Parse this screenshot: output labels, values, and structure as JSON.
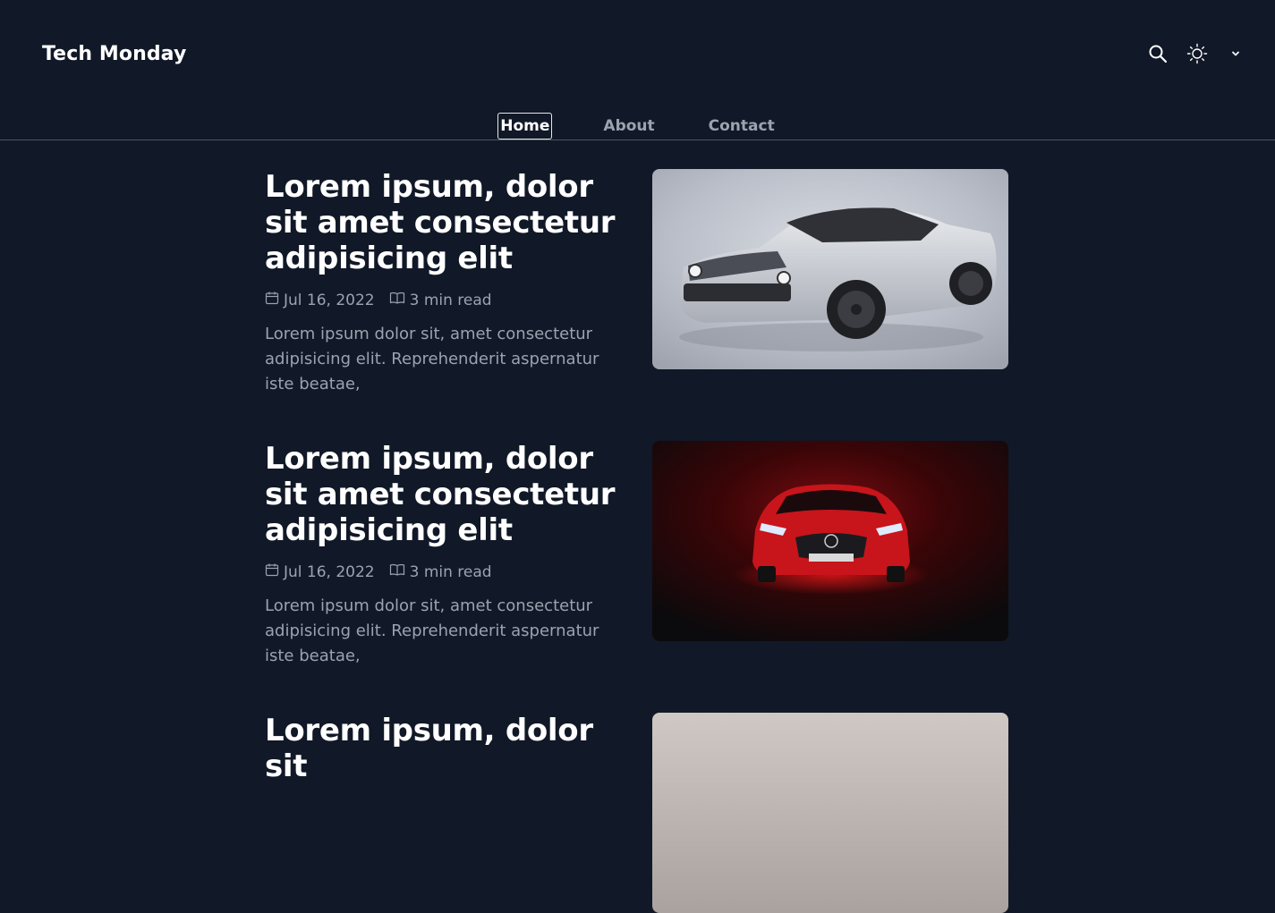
{
  "site": {
    "brand": "Tech Monday"
  },
  "toolbar": {
    "search_icon": "search-icon",
    "theme_icon": "sun-icon",
    "menu_icon": "chevron-down-icon"
  },
  "nav": {
    "items": [
      {
        "label": "Home",
        "active": true
      },
      {
        "label": "About",
        "active": false
      },
      {
        "label": "Contact",
        "active": false
      }
    ]
  },
  "posts": [
    {
      "title": "Lorem ipsum, dolor sit amet consectetur adipisicing elit",
      "date": "Jul 16, 2022",
      "read_time": "3 min read",
      "excerpt": "Lorem ipsum dolor sit, amet consectetur adipisicing elit. Reprehenderit aspernatur iste beatae,",
      "image": "silver-muscle-car"
    },
    {
      "title": "Lorem ipsum, dolor sit amet consectetur adipisicing elit",
      "date": "Jul 16, 2022",
      "read_time": "3 min read",
      "excerpt": "Lorem ipsum dolor sit, amet consectetur adipisicing elit. Reprehenderit aspernatur iste beatae,",
      "image": "red-sports-car"
    },
    {
      "title": "Lorem ipsum, dolor sit",
      "image": "light-gray-image"
    }
  ],
  "colors": {
    "background": "#111827",
    "text": "#ffffff",
    "muted": "#9ca3af",
    "divider": "#4b5563"
  }
}
